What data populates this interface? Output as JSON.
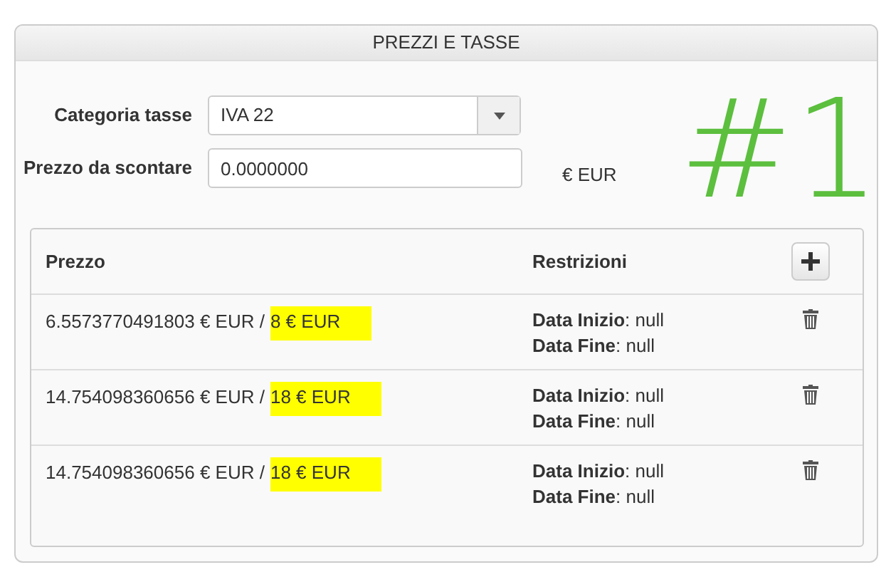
{
  "panel": {
    "title": "PREZZI E TASSE"
  },
  "form": {
    "tax_category": {
      "label": "Categoria tasse",
      "value": "IVA 22"
    },
    "price": {
      "label": "Prezzo da scontare",
      "value": "0.0000000",
      "unit": "€ EUR"
    }
  },
  "annotation": "#1",
  "table": {
    "columns": [
      "Prezzo",
      "Restrizioni"
    ],
    "rows": [
      {
        "net": "6.5573770491803 € EUR /",
        "gross": "8 € EUR",
        "highlighted": true,
        "restrictions": [
          "**Data Inizio**: null",
          "**Data Fine**: null"
        ]
      },
      {
        "net": "14.754098360656 € EUR /",
        "gross": "18 € EUR",
        "highlighted": true,
        "restrictions": [
          "**Data Inizio**: null",
          "**Data Fine**: null"
        ]
      },
      {
        "net": "14.754098360656 € EUR /",
        "gross": "18 € EUR",
        "highlighted": true,
        "restrictions": [
          "**Data Inizio**: null",
          "**Data Fine**: null"
        ]
      }
    ]
  }
}
